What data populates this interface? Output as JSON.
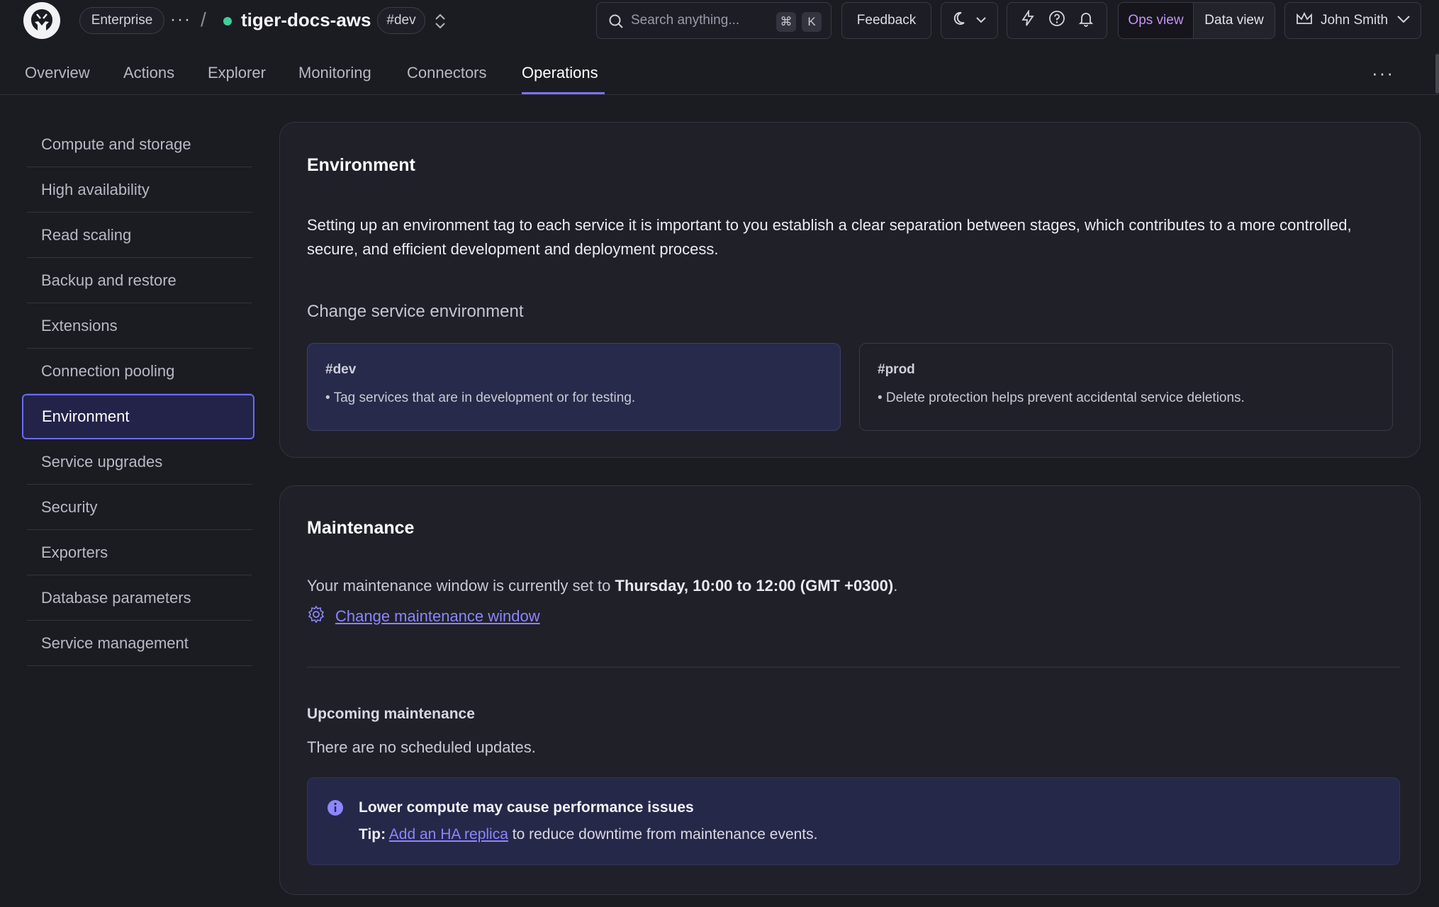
{
  "topbar": {
    "org": "Enterprise",
    "more": "···",
    "separator": "/",
    "service_name": "tiger-docs-aws",
    "env_tag": "#dev",
    "search_placeholder": "Search anything...",
    "shortcut_cmd": "⌘",
    "shortcut_key": "K",
    "feedback": "Feedback",
    "ops_view": "Ops view",
    "data_view": "Data view",
    "user": "John Smith"
  },
  "tabs": [
    {
      "label": "Overview"
    },
    {
      "label": "Actions"
    },
    {
      "label": "Explorer"
    },
    {
      "label": "Monitoring"
    },
    {
      "label": "Connectors"
    },
    {
      "label": "Operations"
    }
  ],
  "tabs_more": "···",
  "sidebar": {
    "items": [
      {
        "label": "Compute and storage"
      },
      {
        "label": "High availability"
      },
      {
        "label": "Read scaling"
      },
      {
        "label": "Backup and restore"
      },
      {
        "label": "Extensions"
      },
      {
        "label": "Connection pooling"
      },
      {
        "label": "Environment"
      },
      {
        "label": "Service upgrades"
      },
      {
        "label": "Security"
      },
      {
        "label": "Exporters"
      },
      {
        "label": "Database parameters"
      },
      {
        "label": "Service management"
      }
    ]
  },
  "environment": {
    "title": "Environment",
    "description": "Setting up an environment tag to each service it is important to you establish a clear separation between stages, which contributes to a more controlled, secure, and efficient development and deployment process.",
    "change_heading": "Change service environment",
    "options": [
      {
        "tag": "#dev",
        "bullet": "• Tag services that are in development or for testing."
      },
      {
        "tag": "#prod",
        "bullet": "• Delete protection helps prevent accidental service deletions."
      }
    ]
  },
  "maintenance": {
    "title": "Maintenance",
    "window_prefix": "Your maintenance window is currently set to ",
    "window_value": "Thursday, 10:00 to 12:00 (GMT +0300)",
    "window_suffix": ".",
    "change_link": "Change maintenance window",
    "upcoming_heading": "Upcoming maintenance",
    "no_updates": "There are no scheduled updates.",
    "banner_title": "Lower compute may cause performance issues",
    "tip_label": "Tip:",
    "tip_link": "Add an HA replica",
    "tip_suffix": " to reduce downtime from maintenance events."
  },
  "colors": {
    "accent": "#7b72f0",
    "link": "#8c86ff",
    "status_ok": "#3ecf9a",
    "ops_view": "#c792f5"
  }
}
